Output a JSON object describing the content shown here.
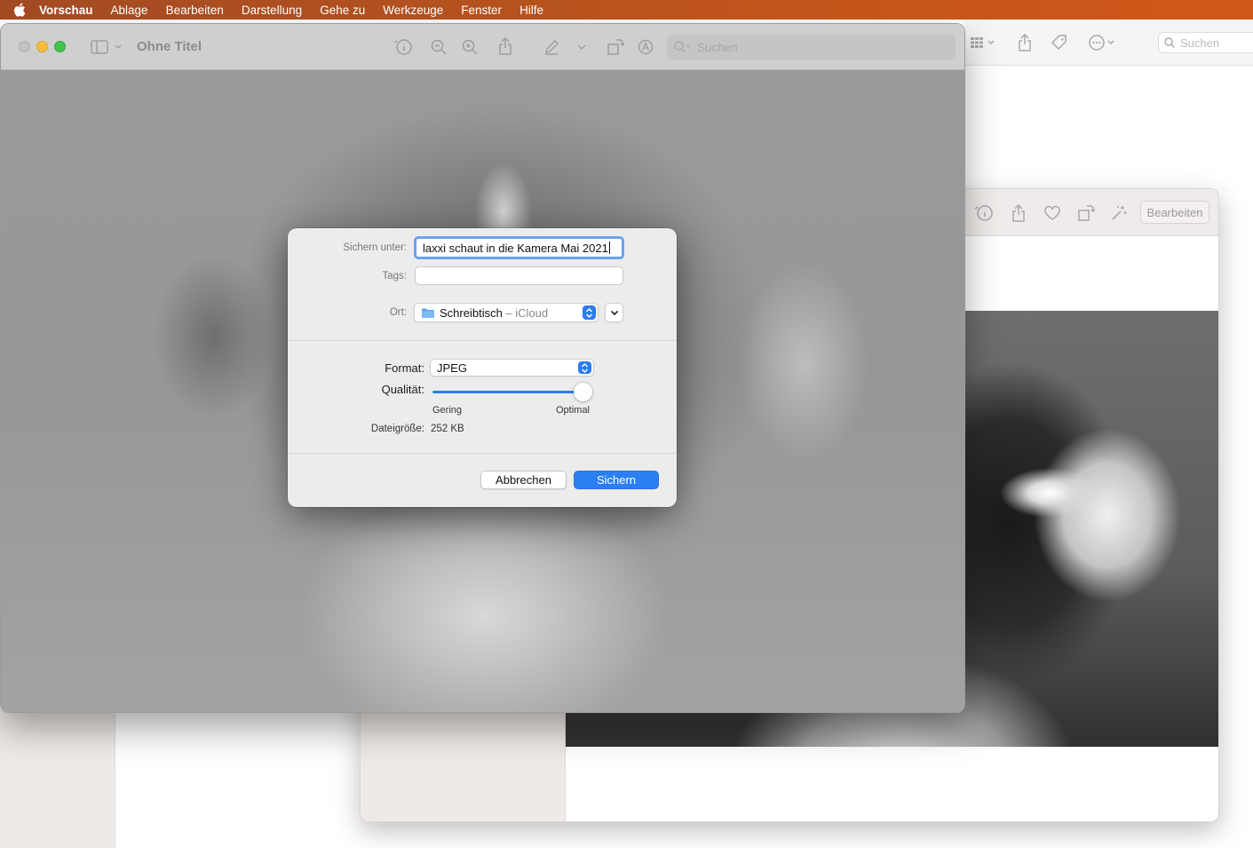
{
  "menubar": {
    "app_name": "Vorschau",
    "items": [
      "Ablage",
      "Bearbeiten",
      "Darstellung",
      "Gehe zu",
      "Werkzeuge",
      "Fenster",
      "Hilfe"
    ]
  },
  "background_app": {
    "search_placeholder": "Suchen"
  },
  "preview_window_back": {
    "edit_button": "Bearbeiten"
  },
  "preview_window": {
    "title": "Ohne Titel",
    "search_placeholder": "Suchen"
  },
  "save_dialog": {
    "save_as_label": "Sichern unter:",
    "save_as_value": "laxxi schaut in die Kamera Mai 2021",
    "tags_label": "Tags:",
    "tags_value": "",
    "location_label": "Ort:",
    "location_name": "Schreibtisch",
    "location_suffix": " – iCloud",
    "format_label": "Format:",
    "format_value": "JPEG",
    "quality_label": "Qualität:",
    "quality_level": 0.94,
    "quality_min_label": "Gering",
    "quality_max_label": "Optimal",
    "filesize_label": "Dateigröße:",
    "filesize_value": "252 KB",
    "cancel_label": "Abbrechen",
    "save_label": "Sichern"
  },
  "colors": {
    "accent": "#2b7ff2",
    "menubar": "#c5561a",
    "close": "#c2c2c2"
  }
}
